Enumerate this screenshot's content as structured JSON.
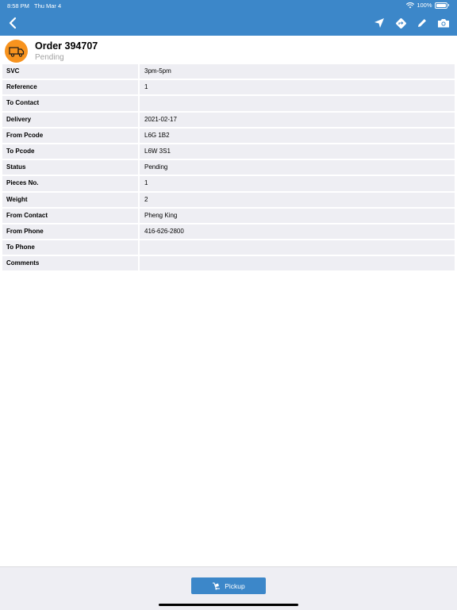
{
  "status_bar": {
    "time": "8:58 PM",
    "date": "Thu Mar 4",
    "battery": "100%"
  },
  "header": {
    "back_icon": "chevron-left-icon",
    "actions": [
      "location-arrow-icon",
      "directions-icon",
      "pencil-icon",
      "camera-icon"
    ],
    "color": "#3c87c9"
  },
  "order": {
    "title": "Order 394707",
    "status": "Pending",
    "avatar_icon": "truck-icon",
    "avatar_color": "#f7931e"
  },
  "details": [
    {
      "label": "SVC",
      "value": "3pm-5pm"
    },
    {
      "label": "Reference",
      "value": "1"
    },
    {
      "label": "To Contact",
      "value": ""
    },
    {
      "label": "Delivery",
      "value": "2021-02-17"
    },
    {
      "label": "From Pcode",
      "value": "L6G 1B2"
    },
    {
      "label": "To Pcode",
      "value": "L6W 3S1"
    },
    {
      "label": "Status",
      "value": "Pending"
    },
    {
      "label": "Pieces No.",
      "value": "1"
    },
    {
      "label": "Weight",
      "value": "2"
    },
    {
      "label": "From Contact",
      "value": "Pheng King"
    },
    {
      "label": "From Phone",
      "value": "416-626-2800"
    },
    {
      "label": "To Phone",
      "value": ""
    },
    {
      "label": "Comments",
      "value": ""
    }
  ],
  "footer": {
    "pickup_label": "Pickup",
    "pickup_icon": "hand-truck-icon"
  }
}
